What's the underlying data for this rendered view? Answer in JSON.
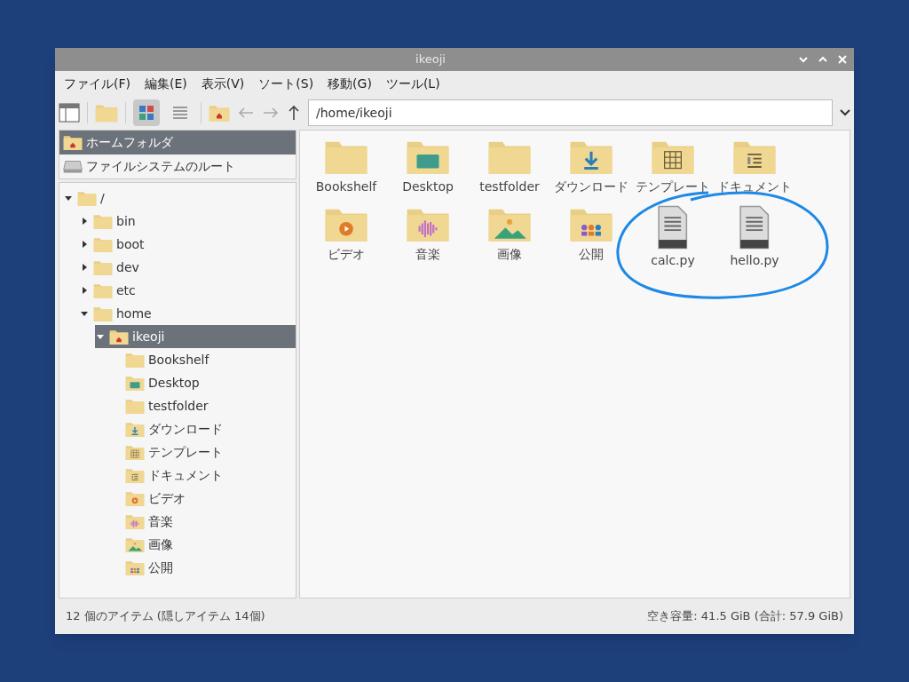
{
  "window": {
    "title": "ikeoji"
  },
  "menu": [
    "ファイル(F)",
    "編集(E)",
    "表示(V)",
    "ソート(S)",
    "移動(G)",
    "ツール(L)"
  ],
  "toolbar": {
    "view_modes": [
      {
        "kind": "icons",
        "selected": true
      },
      {
        "kind": "list",
        "selected": false
      }
    ],
    "path": "/home/ikeoji"
  },
  "places": [
    {
      "label": "ホームフォルダ",
      "kind": "home",
      "selected": true
    },
    {
      "label": "ファイルシステムのルート",
      "kind": "drive",
      "selected": false
    }
  ],
  "tree": [
    {
      "label": "/",
      "kind": "folder",
      "expanded": true,
      "selected": false,
      "children": [
        {
          "label": "bin",
          "kind": "folder",
          "expanded": false,
          "selected": false
        },
        {
          "label": "boot",
          "kind": "folder",
          "expanded": false,
          "selected": false
        },
        {
          "label": "dev",
          "kind": "folder",
          "expanded": false,
          "selected": false
        },
        {
          "label": "etc",
          "kind": "folder",
          "expanded": false,
          "selected": false
        },
        {
          "label": "home",
          "kind": "folder",
          "expanded": true,
          "selected": false,
          "children": [
            {
              "label": "ikeoji",
              "kind": "home",
              "expanded": true,
              "selected": true,
              "children": [
                {
                  "label": "Bookshelf",
                  "kind": "folder"
                },
                {
                  "label": "Desktop",
                  "kind": "desktop"
                },
                {
                  "label": "testfolder",
                  "kind": "folder"
                },
                {
                  "label": "ダウンロード",
                  "kind": "download"
                },
                {
                  "label": "テンプレート",
                  "kind": "template"
                },
                {
                  "label": "ドキュメント",
                  "kind": "document"
                },
                {
                  "label": "ビデオ",
                  "kind": "video"
                },
                {
                  "label": "音楽",
                  "kind": "music"
                },
                {
                  "label": "画像",
                  "kind": "pictures"
                },
                {
                  "label": "公開",
                  "kind": "public"
                }
              ]
            }
          ]
        }
      ]
    }
  ],
  "files": [
    {
      "name": "Bookshelf",
      "kind": "folder"
    },
    {
      "name": "Desktop",
      "kind": "desktop"
    },
    {
      "name": "testfolder",
      "kind": "folder"
    },
    {
      "name": "ダウンロード",
      "kind": "download"
    },
    {
      "name": "テンプレート",
      "kind": "template"
    },
    {
      "name": "ドキュメント",
      "kind": "document"
    },
    {
      "name": "ビデオ",
      "kind": "video"
    },
    {
      "name": "音楽",
      "kind": "music"
    },
    {
      "name": "画像",
      "kind": "pictures"
    },
    {
      "name": "公開",
      "kind": "public"
    },
    {
      "name": "calc.py",
      "kind": "file"
    },
    {
      "name": "hello.py",
      "kind": "file"
    }
  ],
  "status_bar": {
    "items": "12 個のアイテム (隠しアイテム 14個)",
    "free_space": "空き容量: 41.5 GiB (合計: 57.9 GiB)"
  }
}
